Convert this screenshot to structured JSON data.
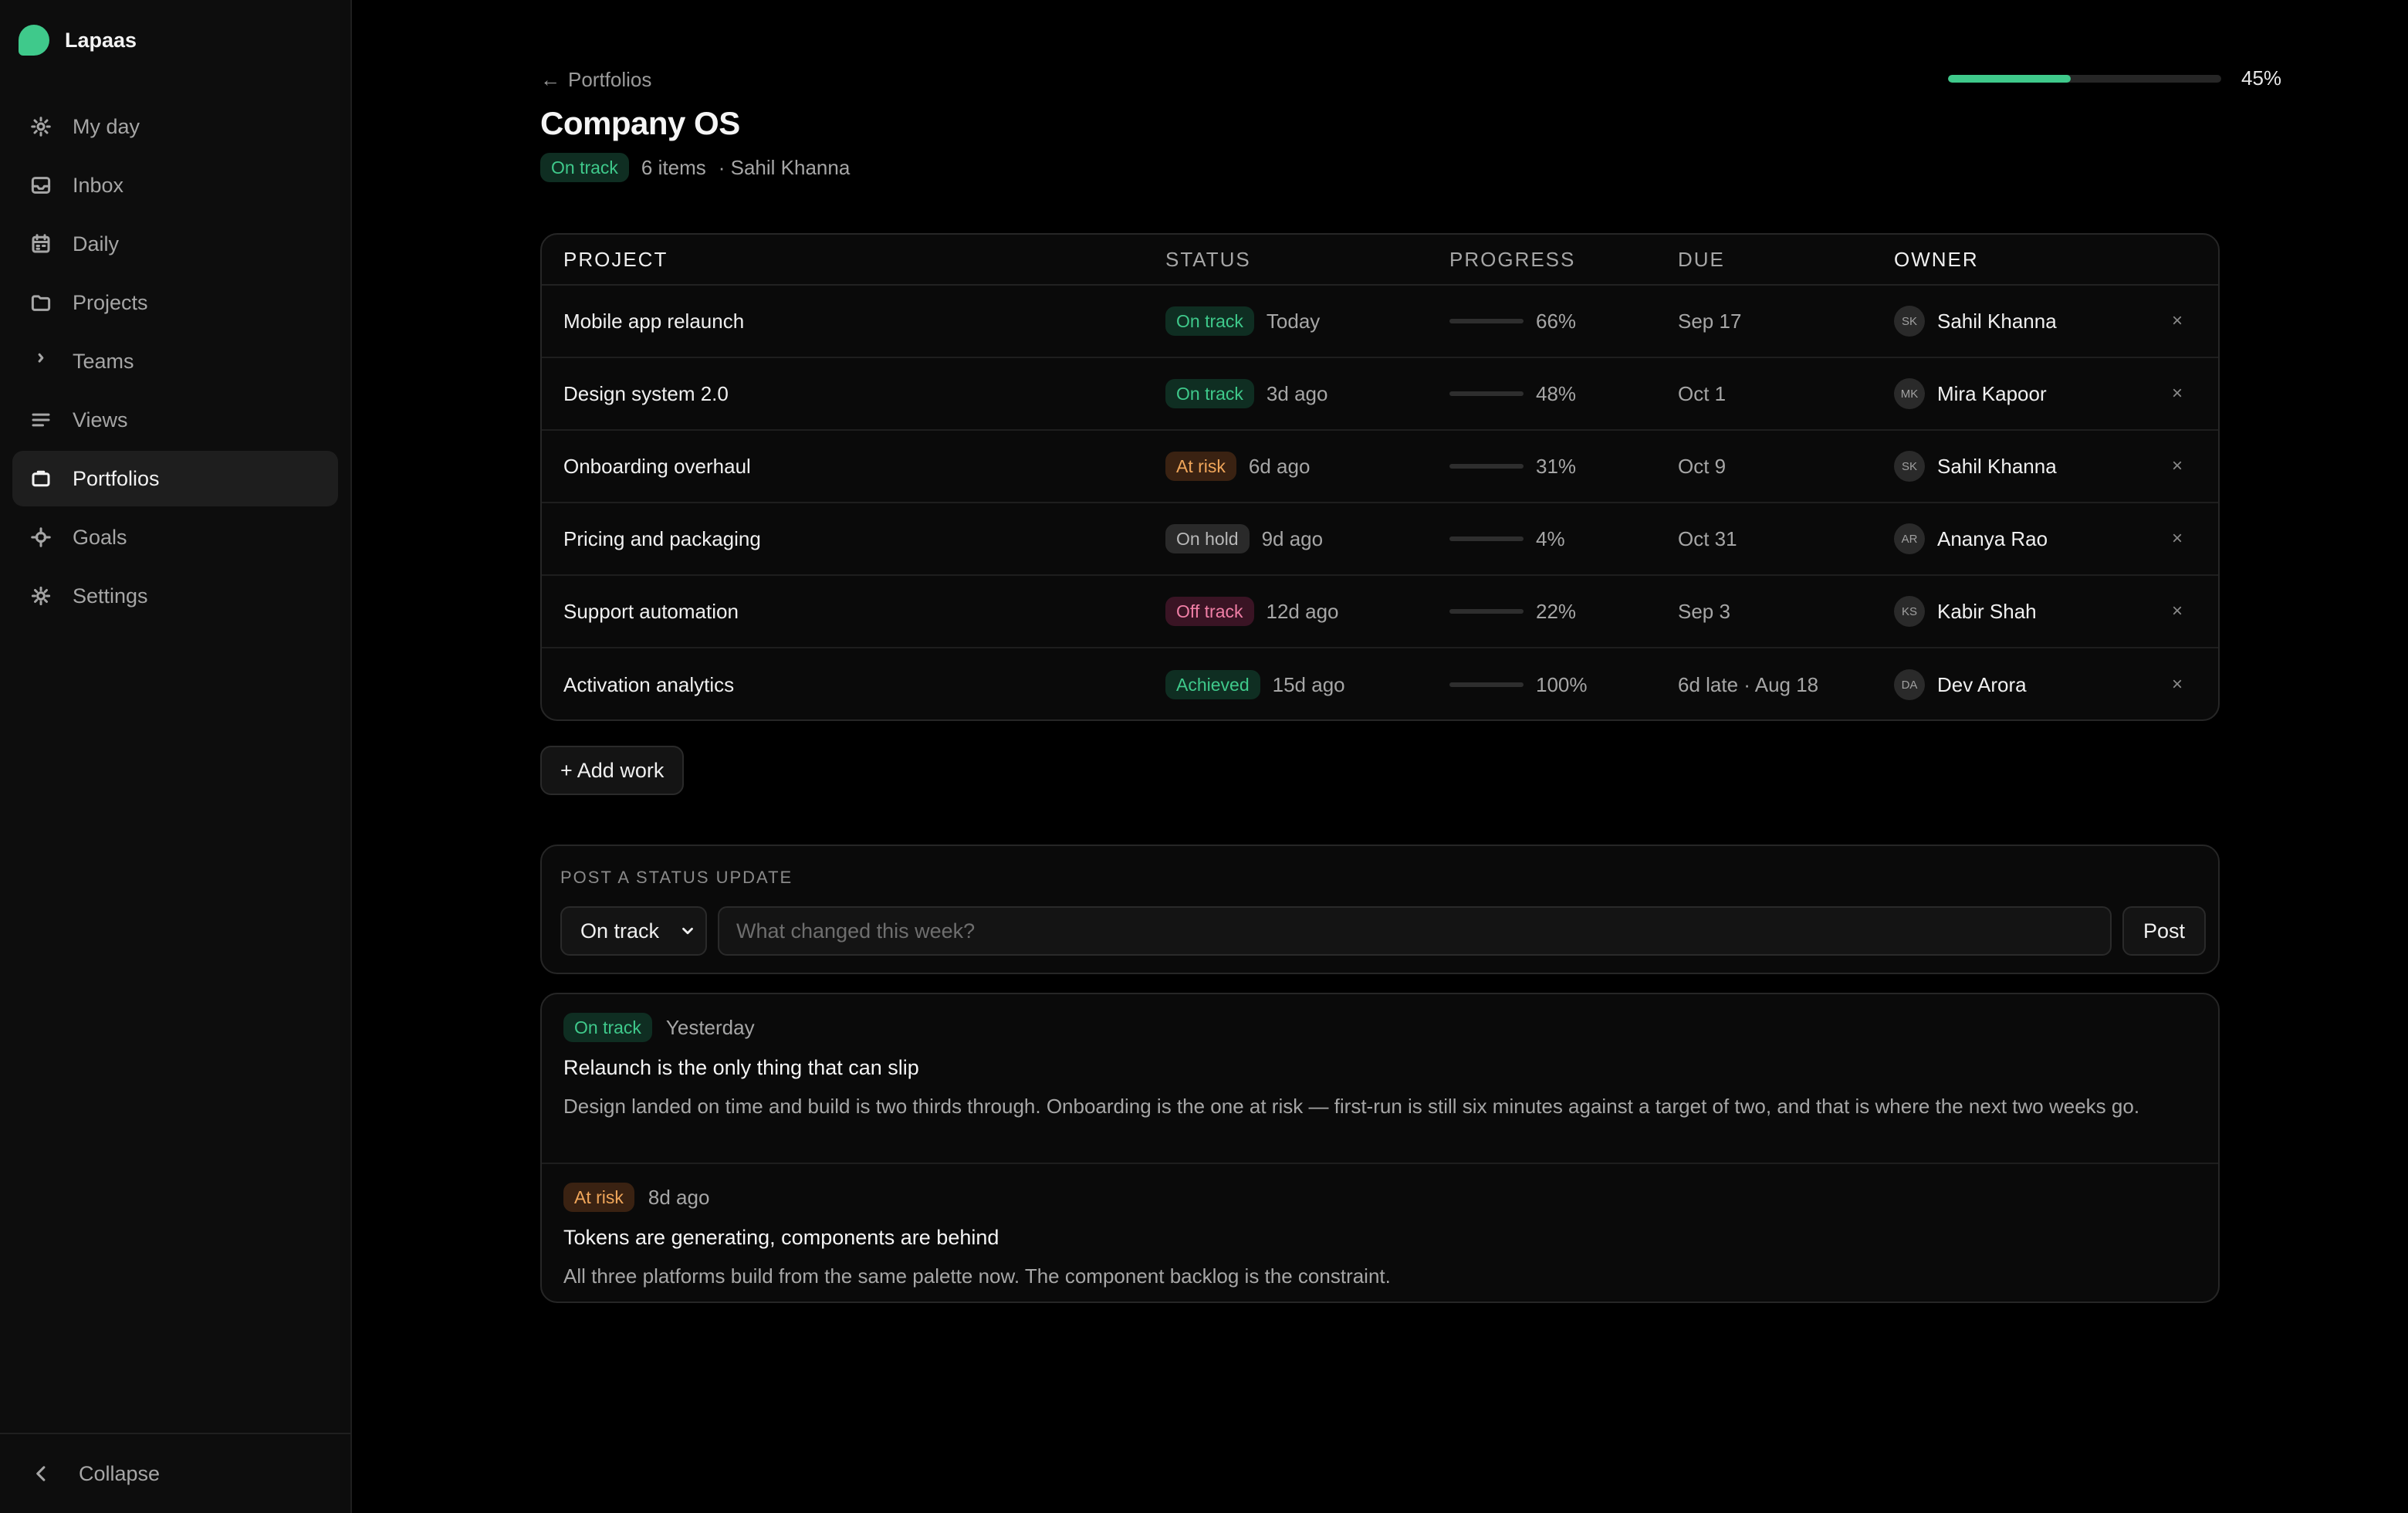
{
  "brand": {
    "name": "Lapaas",
    "color": "#3fc98b"
  },
  "sidebar": {
    "items": [
      {
        "label": "My day",
        "icon": "sun-icon",
        "active": false
      },
      {
        "label": "Inbox",
        "icon": "inbox-icon",
        "active": false
      },
      {
        "label": "Daily",
        "icon": "calendar-icon",
        "active": false
      },
      {
        "label": "Projects",
        "icon": "folder-icon",
        "active": false
      },
      {
        "label": "Teams",
        "icon": "chevron-right-icon",
        "active": false
      },
      {
        "label": "Views",
        "icon": "list-icon",
        "active": false
      },
      {
        "label": "Portfolios",
        "icon": "briefcase-icon",
        "active": true
      },
      {
        "label": "Goals",
        "icon": "target-icon",
        "active": false
      },
      {
        "label": "Settings",
        "icon": "gear-icon",
        "active": false
      }
    ],
    "collapse_label": "Collapse"
  },
  "header": {
    "back_label": "Portfolios",
    "title": "Company OS",
    "status": "On track",
    "items_count": "6 items",
    "owner": "· Sahil Khanna",
    "overall_progress": 0.45,
    "overall_progress_label": "45%"
  },
  "table": {
    "columns": [
      "Project",
      "Status",
      "Progress",
      "Due",
      "Owner"
    ],
    "rows": [
      {
        "project": "Mobile app relaunch",
        "status": "On track",
        "status_kind": "on-track",
        "updated": "Today",
        "progress": 0.66,
        "progress_label": "66%",
        "due": "Sep 17",
        "owner_initials": "SK",
        "owner": "Sahil Khanna"
      },
      {
        "project": "Design system 2.0",
        "status": "On track",
        "status_kind": "on-track",
        "updated": "3d ago",
        "progress": 0.48,
        "progress_label": "48%",
        "due": "Oct 1",
        "owner_initials": "MK",
        "owner": "Mira Kapoor"
      },
      {
        "project": "Onboarding overhaul",
        "status": "At risk",
        "status_kind": "at-risk",
        "updated": "6d ago",
        "progress": 0.31,
        "progress_label": "31%",
        "due": "Oct 9",
        "owner_initials": "SK",
        "owner": "Sahil Khanna"
      },
      {
        "project": "Pricing and packaging",
        "status": "On hold",
        "status_kind": "on-hold",
        "updated": "9d ago",
        "progress": 0.04,
        "progress_label": "4%",
        "due": "Oct 31",
        "owner_initials": "AR",
        "owner": "Ananya Rao"
      },
      {
        "project": "Support automation",
        "status": "Off track",
        "status_kind": "off-track",
        "updated": "12d ago",
        "progress": 0.22,
        "progress_label": "22%",
        "due": "Sep 3",
        "owner_initials": "KS",
        "owner": "Kabir Shah"
      },
      {
        "project": "Activation analytics",
        "status": "Achieved",
        "status_kind": "achieved",
        "updated": "15d ago",
        "progress": 1.0,
        "progress_label": "100%",
        "due": "6d late · Aug 18",
        "owner_initials": "DA",
        "owner": "Dev Arora"
      }
    ],
    "remove_glyph": "×"
  },
  "add_work_label": "+ Add work",
  "composer": {
    "label": "POST A STATUS UPDATE",
    "selected_status": "On track",
    "placeholder": "What changed this week?",
    "value": "",
    "post_label": "Post"
  },
  "updates": [
    {
      "status": "On track",
      "status_kind": "on-track",
      "when": "Yesterday",
      "title": "Relaunch is the only thing that can slip",
      "body": "Design landed on time and build is two thirds through. Onboarding is the one at risk — first-run is still six minutes against a target of two, and that is where the next two weeks go."
    },
    {
      "status": "At risk",
      "status_kind": "at-risk",
      "when": "8d ago",
      "title": "Tokens are generating, components are behind",
      "body": "All three platforms build from the same palette now. The component backlog is the constraint."
    }
  ],
  "colors": {
    "accent": "#3fc98b",
    "progress_track": "#2e2e2e",
    "progress_fill": "#d9d9d9",
    "progress_complete": "#3fc98b"
  }
}
